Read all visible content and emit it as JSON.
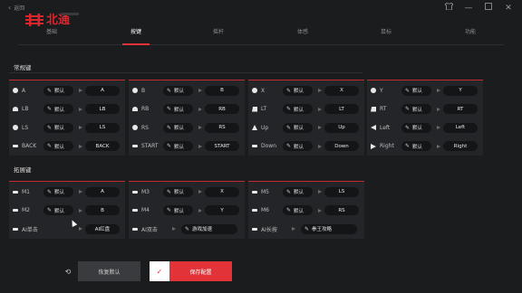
{
  "header": {
    "back_label": "返回",
    "logo_text": "北通",
    "window_buttons": [
      "shirt-icon",
      "minimize-icon",
      "maximize-icon",
      "close-icon"
    ]
  },
  "tabs": [
    {
      "label": "基础",
      "active": false
    },
    {
      "label": "按键",
      "active": true
    },
    {
      "label": "摇杆",
      "active": false
    },
    {
      "label": "体感",
      "active": false
    },
    {
      "label": "鼠标",
      "active": false
    },
    {
      "label": "功能",
      "active": false
    }
  ],
  "common_section": {
    "title": "常规键",
    "columns": [
      [
        {
          "icon": "circle-icon",
          "name": "A",
          "mode": "默认",
          "value": "A"
        },
        {
          "icon": "bumper-icon",
          "name": "LB",
          "mode": "默认",
          "value": "LB"
        },
        {
          "icon": "circle-icon",
          "name": "LS",
          "mode": "默认",
          "value": "LS"
        },
        {
          "icon": "bar-icon",
          "name": "BACK",
          "mode": "默认",
          "value": "BACK"
        }
      ],
      [
        {
          "icon": "circle-icon",
          "name": "B",
          "mode": "默认",
          "value": "B"
        },
        {
          "icon": "bumper-icon",
          "name": "RB",
          "mode": "默认",
          "value": "RB"
        },
        {
          "icon": "circle-icon",
          "name": "RS",
          "mode": "默认",
          "value": "RS"
        },
        {
          "icon": "bar-icon",
          "name": "START",
          "mode": "默认",
          "value": "START"
        }
      ],
      [
        {
          "icon": "circle-icon",
          "name": "X",
          "mode": "默认",
          "value": "X"
        },
        {
          "icon": "trigger-icon",
          "name": "LT",
          "mode": "默认",
          "value": "LT"
        },
        {
          "icon": "triangle-up-icon",
          "name": "Up",
          "mode": "默认",
          "value": "Up"
        },
        {
          "icon": "bar-icon",
          "name": "Down",
          "mode": "默认",
          "value": "Down"
        }
      ],
      [
        {
          "icon": "circle-icon",
          "name": "Y",
          "mode": "默认",
          "value": "Y"
        },
        {
          "icon": "trigger-icon",
          "name": "RT",
          "mode": "默认",
          "value": "RT"
        },
        {
          "icon": "triangle-left-icon",
          "name": "Left",
          "mode": "默认",
          "value": "Left"
        },
        {
          "icon": "triangle-right-icon",
          "name": "Right",
          "mode": "默认",
          "value": "Right"
        }
      ]
    ]
  },
  "extended_section": {
    "title": "拓展键",
    "columns": [
      [
        {
          "icon": "bar-icon",
          "name": "M1",
          "mode": "默认",
          "value": "A"
        },
        {
          "icon": "bar-icon",
          "name": "M2",
          "mode": "默认",
          "value": "B"
        },
        {
          "icon": "bar-icon",
          "name": "AI单击",
          "mode": "",
          "value": "AI红盘"
        }
      ],
      [
        {
          "icon": "bar-icon",
          "name": "M3",
          "mode": "默认",
          "value": "X"
        },
        {
          "icon": "bar-icon",
          "name": "M4",
          "mode": "默认",
          "value": "Y"
        },
        {
          "icon": "bar-icon",
          "name": "AI双击",
          "mode": "游戏加速",
          "value": ""
        }
      ],
      [
        {
          "icon": "bar-icon",
          "name": "M5",
          "mode": "默认",
          "value": "LS"
        },
        {
          "icon": "bar-icon",
          "name": "M6",
          "mode": "默认",
          "value": "RS"
        },
        {
          "icon": "bar-icon",
          "name": "AI长按",
          "mode": "拳王攻略",
          "value": ""
        }
      ]
    ]
  },
  "footer": {
    "reset_label": "恢复默认",
    "save_label": "保存配置"
  },
  "colors": {
    "accent": "#e23338",
    "background": "#1b1c1e",
    "panel": "#242528"
  }
}
